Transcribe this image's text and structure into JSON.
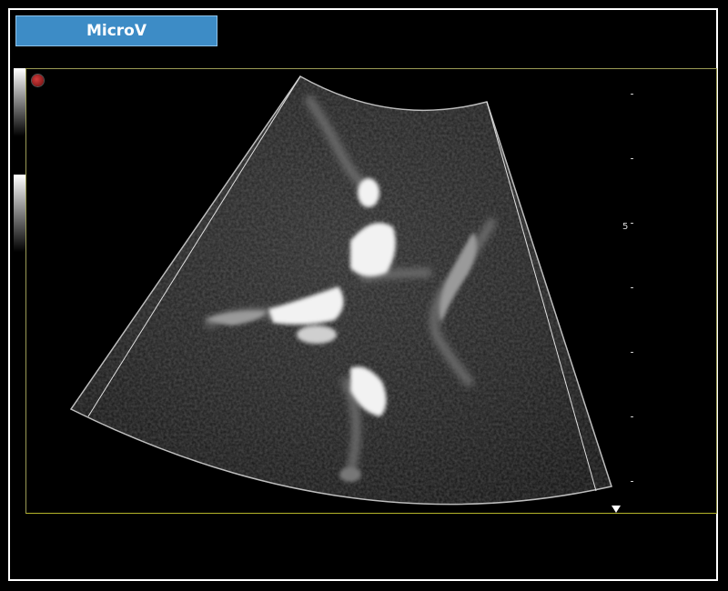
{
  "mode_label": "MicroV",
  "depth_scale_label": "5"
}
